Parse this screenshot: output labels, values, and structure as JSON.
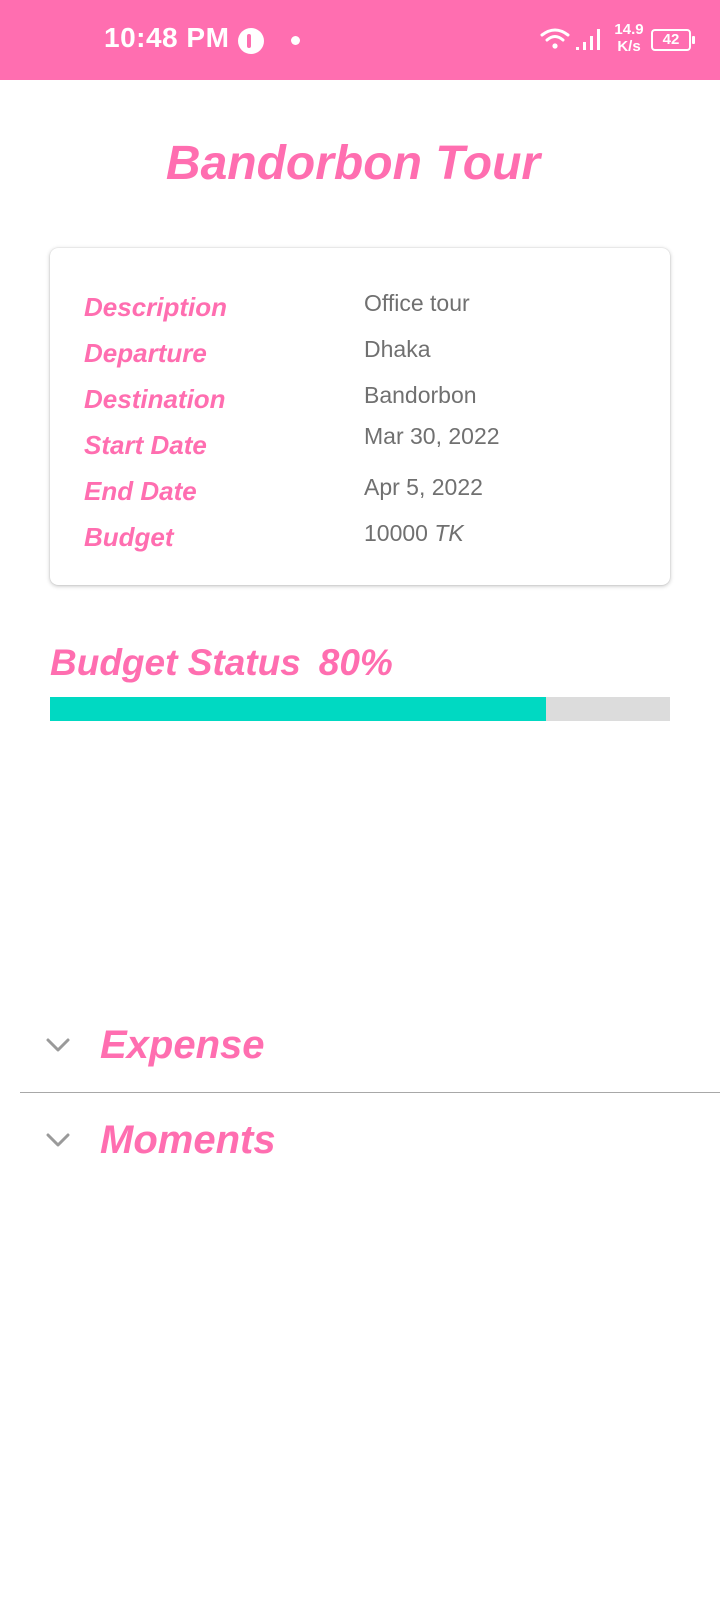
{
  "status_bar": {
    "time": "10:48 PM",
    "net_speed_value": "14.9",
    "net_speed_unit": "K/s",
    "battery": "42",
    "icons": [
      "app-badge-icon",
      "notification-dot-icon",
      "wifi-icon",
      "signal-icon",
      "battery-icon"
    ]
  },
  "page": {
    "title": "Bandorbon Tour"
  },
  "details": [
    {
      "label": "Description",
      "value": "Office tour"
    },
    {
      "label": "Departure",
      "value": "Dhaka"
    },
    {
      "label": "Destination",
      "value": "Bandorbon"
    },
    {
      "label": "Start Date",
      "value": "Mar 30, 2022"
    },
    {
      "label": "End Date",
      "value": "Apr 5, 2022"
    },
    {
      "label": "Budget",
      "value": "10000",
      "unit": "TK"
    }
  ],
  "budget_status": {
    "label": "Budget Status",
    "percent_text": "80%",
    "percent_value": 80
  },
  "sections": [
    {
      "title": "Expense",
      "icon": "chevron-down-icon"
    },
    {
      "title": "Moments",
      "icon": "chevron-down-icon"
    }
  ],
  "colors": {
    "accent": "#ff6eb0",
    "progress_fill": "#00d9c2",
    "progress_track": "#dcdcdc",
    "value_text": "#707070"
  }
}
